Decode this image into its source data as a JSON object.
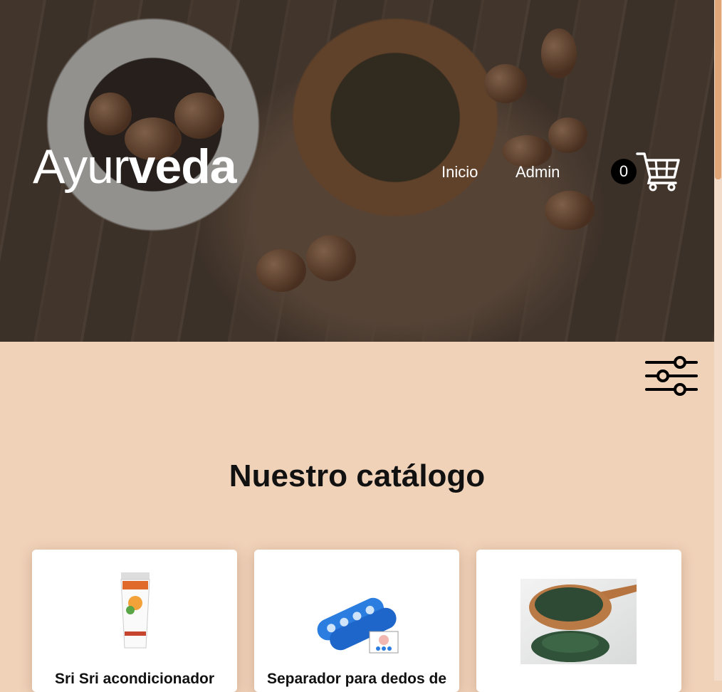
{
  "header": {
    "logo_light": "Ayur",
    "logo_bold": "veda",
    "nav": [
      "Inicio",
      "Admin"
    ],
    "cart_count": "0"
  },
  "main": {
    "title": "Nuestro catálogo",
    "products": [
      {
        "name": "Sri Sri acondicionador"
      },
      {
        "name": "Separador para dedos de"
      },
      {
        "name": ""
      }
    ]
  },
  "colors": {
    "page_bg": "#f0d2b9",
    "scroll_thumb": "#e2a778"
  },
  "icons": [
    "shopping-cart-icon",
    "filter-sliders-icon"
  ]
}
